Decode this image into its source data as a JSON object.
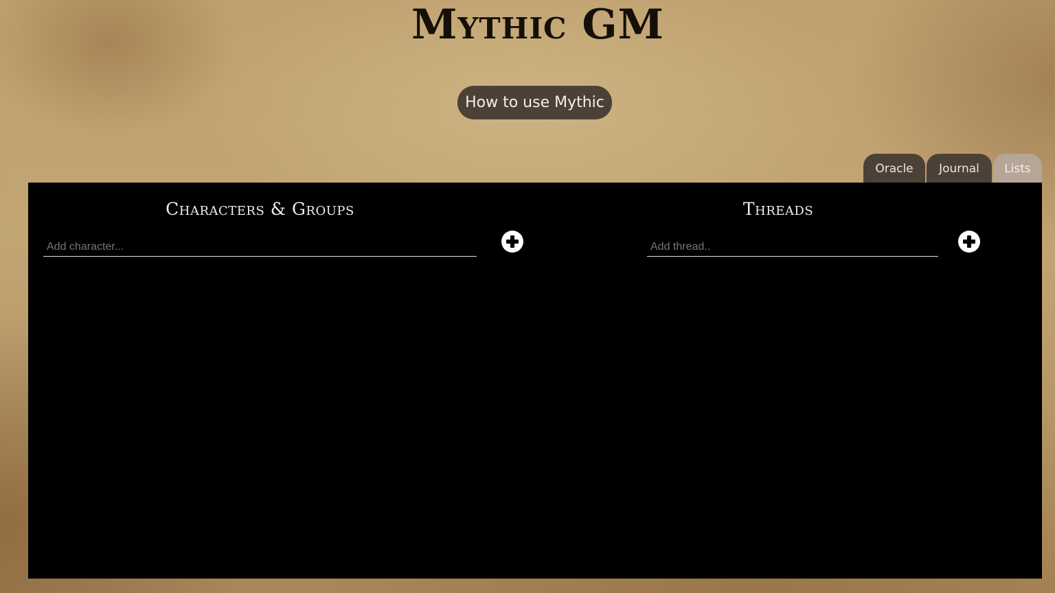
{
  "header": {
    "title": "Mythic GM",
    "help_button_label": "How to use Mythic"
  },
  "tabs": [
    {
      "label": "Oracle",
      "active": false
    },
    {
      "label": "Journal",
      "active": false
    },
    {
      "label": "Lists",
      "active": true
    }
  ],
  "lists_panel": {
    "characters": {
      "title": "Characters & Groups",
      "input_placeholder": "Add character...",
      "input_value": "",
      "add_icon": "plus-circle-icon"
    },
    "threads": {
      "title": "Threads",
      "input_placeholder": "Add thread..",
      "input_value": "",
      "add_icon": "plus-circle-icon"
    }
  },
  "colors": {
    "panel_background": "#000000",
    "button_background": "#4c4137",
    "active_tab_background": "#b5a697",
    "parchment": "#c2a575"
  }
}
